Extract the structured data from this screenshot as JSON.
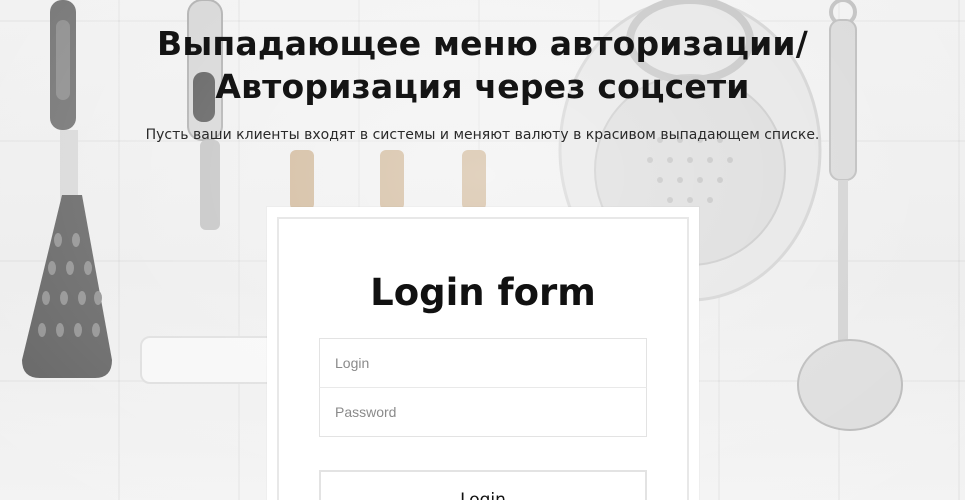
{
  "page": {
    "headline_line1": "Выпадающее меню авторизации/",
    "headline_line2": "Авторизация через соцсети",
    "subline": "Пусть ваши клиенты входят в системы и меняют валюту в красивом выпадающем списке."
  },
  "login_form": {
    "title": "Login form",
    "login_placeholder": "Login",
    "password_placeholder": "Password",
    "submit_label": "Login"
  },
  "background": {
    "scene": "kitchen-utensils-icon",
    "wall_color": "#eeeeee"
  }
}
